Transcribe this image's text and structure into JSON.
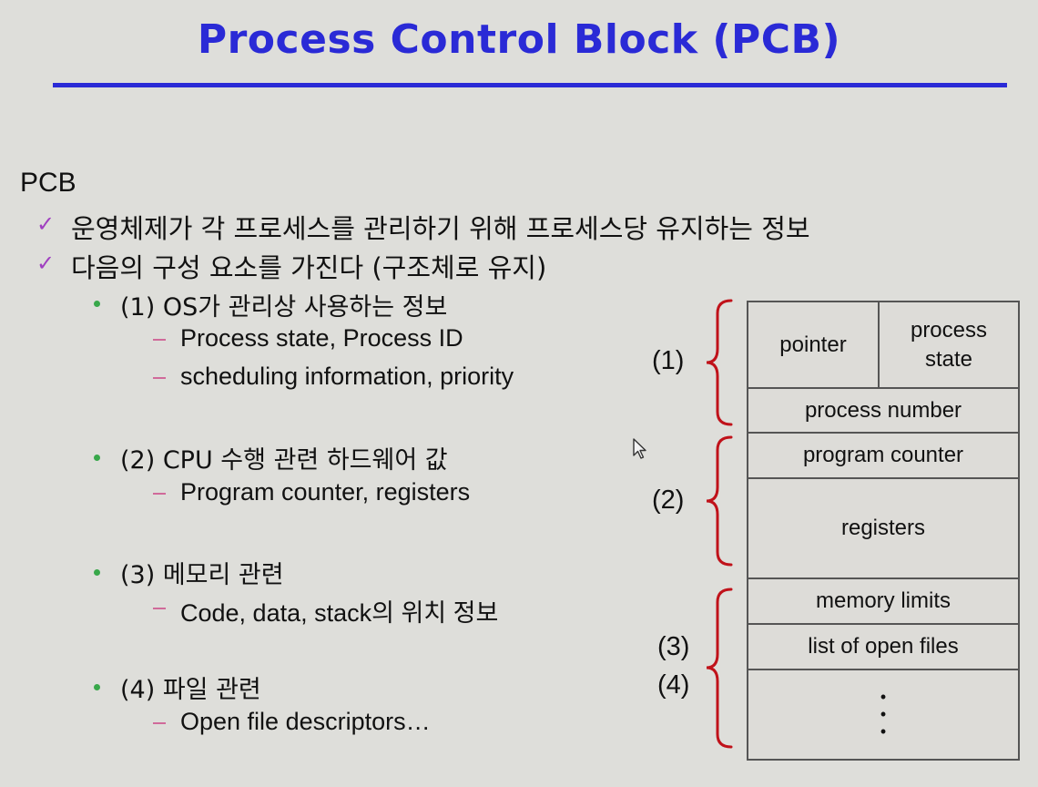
{
  "title": "Process Control Block (PCB)",
  "heading": "PCB",
  "bullets": [
    "운영체제가 각 프로세스를 관리하기 위해 프로세스당 유지하는 정보",
    "다음의 구성 요소를 가진다 (구조체로 유지)"
  ],
  "groups": [
    {
      "label": "(1) OS가 관리상 사용하는 정보",
      "items": [
        "Process state, Process ID",
        "scheduling information, priority"
      ]
    },
    {
      "label": "(2) CPU 수행 관련 하드웨어 값",
      "items": [
        "Program counter, registers"
      ]
    },
    {
      "label": "(3) 메모리 관련",
      "items": [
        "Code, data, stack의 위치 정보"
      ]
    },
    {
      "label": "(4) 파일 관련",
      "items": [
        "Open file descriptors…"
      ]
    }
  ],
  "diagram": {
    "cells": {
      "pointer": "pointer",
      "process_state": "process\nstate",
      "process_number": "process number",
      "program_counter": "program counter",
      "registers": "registers",
      "memory_limits": "memory limits",
      "open_files": "list of open files",
      "ellipsis": "•\n•\n•"
    },
    "brace_labels": [
      "(1)",
      "(2)",
      "(3)",
      "(4)"
    ],
    "brace_color": "#c0121a"
  },
  "colors": {
    "title": "#2a2ad6",
    "check": "#a040c0",
    "bullet": "#38a84a",
    "dash": "#d06a9a"
  }
}
